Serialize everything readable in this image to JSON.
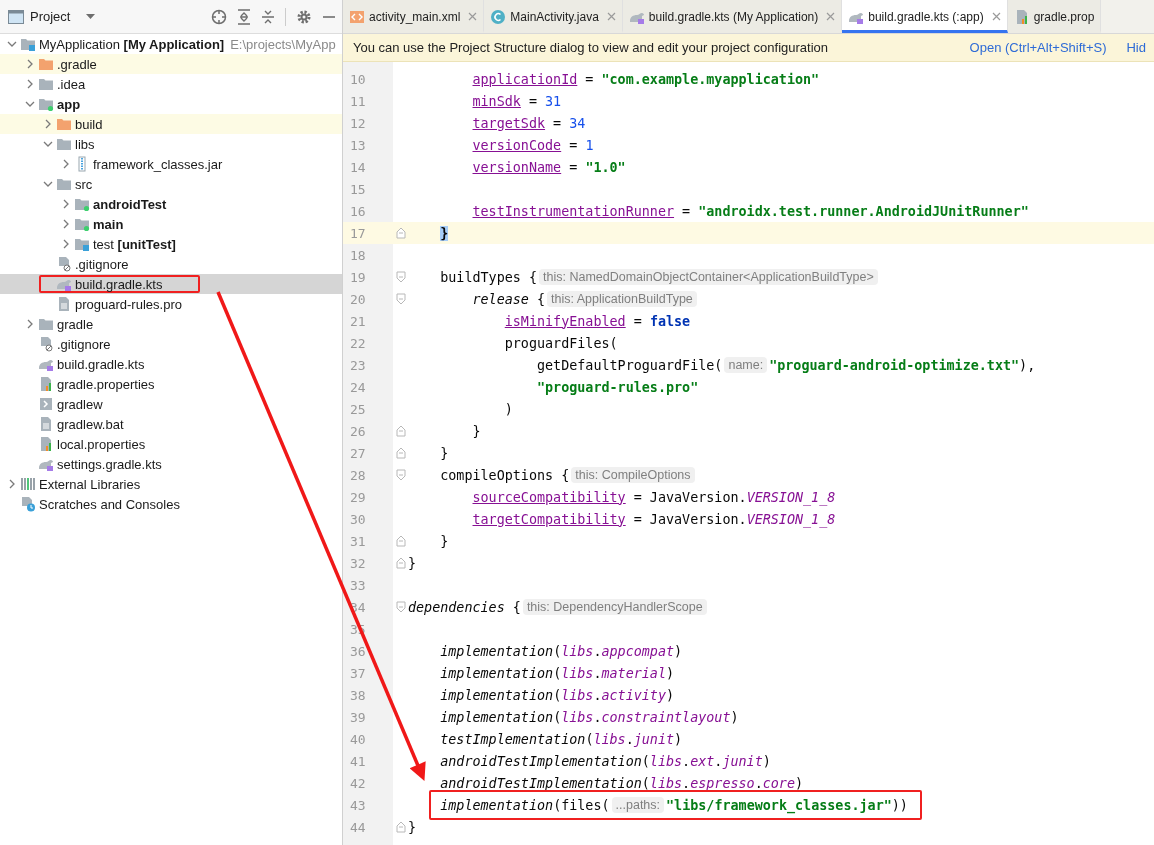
{
  "project_panel": {
    "title": "Project",
    "tree": [
      {
        "label": "MyApplication **[My Application]**",
        "path": "E:\\projects\\MyApp",
        "kind": "project",
        "expanded": true,
        "bold": false,
        "selected": false,
        "excluded": false,
        "highlighted": false,
        "children": [
          {
            "label": ".gradle",
            "kind": "folder-excluded",
            "expanded": false,
            "bold": false,
            "selected": false,
            "excluded": true,
            "highlighted": false
          },
          {
            "label": ".idea",
            "kind": "folder",
            "expanded": false,
            "bold": false,
            "selected": false,
            "excluded": false,
            "highlighted": false
          },
          {
            "label": "app",
            "kind": "module",
            "expanded": true,
            "bold": true,
            "selected": false,
            "excluded": false,
            "highlighted": false,
            "children": [
              {
                "label": "build",
                "kind": "folder-excluded",
                "expanded": false,
                "bold": false,
                "selected": false,
                "excluded": true,
                "highlighted": false
              },
              {
                "label": "libs",
                "kind": "folder",
                "expanded": true,
                "bold": false,
                "selected": false,
                "excluded": false,
                "highlighted": false,
                "children": [
                  {
                    "label": "framework_classes.jar",
                    "kind": "jar",
                    "expanded": false,
                    "bold": false,
                    "selected": false,
                    "excluded": false,
                    "highlighted": false
                  }
                ]
              },
              {
                "label": "src",
                "kind": "folder",
                "expanded": true,
                "bold": false,
                "selected": false,
                "excluded": false,
                "highlighted": false,
                "children": [
                  {
                    "label": "androidTest",
                    "kind": "module",
                    "expanded": false,
                    "bold": true,
                    "selected": false,
                    "excluded": false,
                    "highlighted": false
                  },
                  {
                    "label": "main",
                    "kind": "module",
                    "expanded": false,
                    "bold": true,
                    "selected": false,
                    "excluded": false,
                    "highlighted": false
                  },
                  {
                    "label": "test **[unitTest]**",
                    "kind": "project",
                    "expanded": false,
                    "bold": false,
                    "selected": false,
                    "excluded": false,
                    "highlighted": false
                  }
                ]
              },
              {
                "label": ".gitignore",
                "kind": "ignore",
                "bold": false,
                "selected": false,
                "excluded": false,
                "highlighted": false
              },
              {
                "label": "build.gradle.kts",
                "kind": "gradle",
                "bold": false,
                "selected": true,
                "excluded": false,
                "highlighted": true
              },
              {
                "label": "proguard-rules.pro",
                "kind": "text",
                "bold": false,
                "selected": false,
                "excluded": false,
                "highlighted": false
              }
            ]
          },
          {
            "label": "gradle",
            "kind": "folder",
            "expanded": false,
            "bold": false,
            "selected": false,
            "excluded": false,
            "highlighted": false
          },
          {
            "label": ".gitignore",
            "kind": "ignore",
            "bold": false,
            "selected": false,
            "excluded": false,
            "highlighted": false
          },
          {
            "label": "build.gradle.kts",
            "kind": "gradle",
            "bold": false,
            "selected": false,
            "excluded": false,
            "highlighted": false
          },
          {
            "label": "gradle.properties",
            "kind": "properties",
            "bold": false,
            "selected": false,
            "excluded": false,
            "highlighted": false
          },
          {
            "label": "gradlew",
            "kind": "script",
            "bold": false,
            "selected": false,
            "excluded": false,
            "highlighted": false
          },
          {
            "label": "gradlew.bat",
            "kind": "text",
            "bold": false,
            "selected": false,
            "excluded": false,
            "highlighted": false
          },
          {
            "label": "local.properties",
            "kind": "properties",
            "bold": false,
            "selected": false,
            "excluded": false,
            "highlighted": false
          },
          {
            "label": "settings.gradle.kts",
            "kind": "gradle",
            "bold": false,
            "selected": false,
            "excluded": false,
            "highlighted": false
          }
        ]
      },
      {
        "label": "External Libraries",
        "kind": "libraries",
        "expanded": false,
        "bold": false,
        "selected": false,
        "excluded": false,
        "highlighted": false
      },
      {
        "label": "Scratches and Consoles",
        "kind": "scratches",
        "bold": false,
        "selected": false,
        "excluded": false,
        "highlighted": false
      }
    ]
  },
  "editor_tabs": [
    {
      "label": "activity_main.xml",
      "kind": "xml",
      "selected": false
    },
    {
      "label": "MainActivity.java",
      "kind": "class",
      "selected": false
    },
    {
      "label": "build.gradle.kts (My Application)",
      "kind": "gradle",
      "selected": false
    },
    {
      "label": "build.gradle.kts (:app)",
      "kind": "gradle",
      "selected": true
    },
    {
      "label": "gradle.prop",
      "kind": "properties",
      "selected": false
    }
  ],
  "banner": {
    "message": "You can use the Project Structure dialog to view and edit your project configuration",
    "action": "Open (Ctrl+Alt+Shift+S)",
    "dismiss": "Hid"
  },
  "code_lines": [
    {
      "number": "10",
      "current": false,
      "tokens": [
        {
          "text": "        applicationId",
          "kind": "prop"
        },
        {
          "text": " = ",
          "kind": "plain"
        },
        {
          "text": "\"com.example.myapplication\"",
          "kind": "string"
        }
      ]
    },
    {
      "number": "11",
      "current": false,
      "tokens": [
        {
          "text": "        minSdk",
          "kind": "prop"
        },
        {
          "text": " = ",
          "kind": "plain"
        },
        {
          "text": "31",
          "kind": "number"
        }
      ]
    },
    {
      "number": "12",
      "current": false,
      "tokens": [
        {
          "text": "        targetSdk",
          "kind": "prop"
        },
        {
          "text": " = ",
          "kind": "plain"
        },
        {
          "text": "34",
          "kind": "number"
        }
      ]
    },
    {
      "number": "13",
      "current": false,
      "tokens": [
        {
          "text": "        versionCode",
          "kind": "prop"
        },
        {
          "text": " = ",
          "kind": "plain"
        },
        {
          "text": "1",
          "kind": "number"
        }
      ]
    },
    {
      "number": "14",
      "current": false,
      "tokens": [
        {
          "text": "        versionName",
          "kind": "prop"
        },
        {
          "text": " = ",
          "kind": "plain"
        },
        {
          "text": "\"1.0\"",
          "kind": "string"
        }
      ]
    },
    {
      "number": "15",
      "current": false
    },
    {
      "number": "16",
      "current": false,
      "tokens": [
        {
          "text": "        testInstrumentationRunner",
          "kind": "prop"
        },
        {
          "text": " = ",
          "kind": "plain"
        },
        {
          "text": "\"androidx.test.runner.AndroidJUnitRunner\"",
          "kind": "string"
        }
      ]
    },
    {
      "number": "17",
      "current": true,
      "fold_marker": {
        "kind": "end"
      },
      "tokens": [
        {
          "text": "    }",
          "kind": "brace-match"
        }
      ]
    },
    {
      "number": "18",
      "current": false
    },
    {
      "number": "19",
      "current": false,
      "fold_marker": {
        "kind": "start"
      },
      "tokens": [
        {
          "text": "    buildTypes {",
          "kind": "plain"
        },
        {
          "text": "this: NamedDomainObjectContainer<ApplicationBuildType>",
          "kind": "hint"
        }
      ]
    },
    {
      "number": "20",
      "current": false,
      "fold_marker": {
        "kind": "start"
      },
      "tokens": [
        {
          "text": "        release",
          "kind": "italic"
        },
        {
          "text": " {",
          "kind": "plain"
        },
        {
          "text": "this: ApplicationBuildType",
          "kind": "hint"
        }
      ]
    },
    {
      "number": "21",
      "current": false,
      "tokens": [
        {
          "text": "            isMinifyEnabled",
          "kind": "prop"
        },
        {
          "text": " = ",
          "kind": "plain"
        },
        {
          "text": "false",
          "kind": "keyword"
        }
      ]
    },
    {
      "number": "22",
      "current": false,
      "tokens": [
        {
          "text": "            proguardFiles(",
          "kind": "plain"
        }
      ]
    },
    {
      "number": "23",
      "current": false,
      "tokens": [
        {
          "text": "                getDefaultProguardFile(",
          "kind": "plain"
        },
        {
          "text": "name:",
          "kind": "hint"
        },
        {
          "text": "\"proguard-android-optimize.txt\"",
          "kind": "string"
        },
        {
          "text": "),",
          "kind": "plain"
        }
      ]
    },
    {
      "number": "24",
      "current": false,
      "tokens": [
        {
          "text": "                \"proguard-rules.pro\"",
          "kind": "string"
        }
      ]
    },
    {
      "number": "25",
      "current": false,
      "tokens": [
        {
          "text": "            )",
          "kind": "plain"
        }
      ]
    },
    {
      "number": "26",
      "current": false,
      "fold_marker": {
        "kind": "end"
      },
      "tokens": [
        {
          "text": "        }",
          "kind": "plain"
        }
      ]
    },
    {
      "number": "27",
      "current": false,
      "fold_marker": {
        "kind": "end"
      },
      "tokens": [
        {
          "text": "    }",
          "kind": "plain"
        }
      ]
    },
    {
      "number": "28",
      "current": false,
      "fold_marker": {
        "kind": "start"
      },
      "tokens": [
        {
          "text": "    compileOptions {",
          "kind": "plain"
        },
        {
          "text": "this: CompileOptions",
          "kind": "hint"
        }
      ]
    },
    {
      "number": "29",
      "current": false,
      "tokens": [
        {
          "text": "        sourceCompatibility",
          "kind": "prop"
        },
        {
          "text": " = JavaVersion.",
          "kind": "plain"
        },
        {
          "text": "VERSION_1_8",
          "kind": "member"
        }
      ]
    },
    {
      "number": "30",
      "current": false,
      "tokens": [
        {
          "text": "        targetCompatibility",
          "kind": "prop"
        },
        {
          "text": " = JavaVersion.",
          "kind": "plain"
        },
        {
          "text": "VERSION_1_8",
          "kind": "member"
        }
      ]
    },
    {
      "number": "31",
      "current": false,
      "fold_marker": {
        "kind": "end"
      },
      "tokens": [
        {
          "text": "    }",
          "kind": "plain"
        }
      ]
    },
    {
      "number": "32",
      "current": false,
      "fold_marker": {
        "kind": "end"
      },
      "tokens": [
        {
          "text": "}",
          "kind": "plain"
        }
      ]
    },
    {
      "number": "33",
      "current": false
    },
    {
      "number": "34",
      "current": false,
      "fold_marker": {
        "kind": "start"
      },
      "tokens": [
        {
          "text": "dependencies",
          "kind": "italic"
        },
        {
          "text": " {",
          "kind": "plain"
        },
        {
          "text": "this: DependencyHandlerScope",
          "kind": "hint"
        }
      ]
    },
    {
      "number": "35",
      "current": false
    },
    {
      "number": "36",
      "current": false,
      "tokens": [
        {
          "text": "    implementation",
          "kind": "italic"
        },
        {
          "text": "(",
          "kind": "plain"
        },
        {
          "text": "libs",
          "kind": "member"
        },
        {
          "text": ".",
          "kind": "plain"
        },
        {
          "text": "appcompat",
          "kind": "member"
        },
        {
          "text": ")",
          "kind": "plain"
        }
      ]
    },
    {
      "number": "37",
      "current": false,
      "tokens": [
        {
          "text": "    implementation",
          "kind": "italic"
        },
        {
          "text": "(",
          "kind": "plain"
        },
        {
          "text": "libs",
          "kind": "member"
        },
        {
          "text": ".",
          "kind": "plain"
        },
        {
          "text": "material",
          "kind": "member"
        },
        {
          "text": ")",
          "kind": "plain"
        }
      ]
    },
    {
      "number": "38",
      "current": false,
      "tokens": [
        {
          "text": "    implementation",
          "kind": "italic"
        },
        {
          "text": "(",
          "kind": "plain"
        },
        {
          "text": "libs",
          "kind": "member"
        },
        {
          "text": ".",
          "kind": "plain"
        },
        {
          "text": "activity",
          "kind": "member"
        },
        {
          "text": ")",
          "kind": "plain"
        }
      ]
    },
    {
      "number": "39",
      "current": false,
      "tokens": [
        {
          "text": "    implementation",
          "kind": "italic"
        },
        {
          "text": "(",
          "kind": "plain"
        },
        {
          "text": "libs",
          "kind": "member"
        },
        {
          "text": ".",
          "kind": "plain"
        },
        {
          "text": "constraintlayout",
          "kind": "member"
        },
        {
          "text": ")",
          "kind": "plain"
        }
      ]
    },
    {
      "number": "40",
      "current": false,
      "tokens": [
        {
          "text": "    testImplementation",
          "kind": "italic"
        },
        {
          "text": "(",
          "kind": "plain"
        },
        {
          "text": "libs",
          "kind": "member"
        },
        {
          "text": ".",
          "kind": "plain"
        },
        {
          "text": "junit",
          "kind": "member"
        },
        {
          "text": ")",
          "kind": "plain"
        }
      ]
    },
    {
      "number": "41",
      "current": false,
      "tokens": [
        {
          "text": "    androidTestImplementation",
          "kind": "italic"
        },
        {
          "text": "(",
          "kind": "plain"
        },
        {
          "text": "libs",
          "kind": "member"
        },
        {
          "text": ".",
          "kind": "plain"
        },
        {
          "text": "ext",
          "kind": "member"
        },
        {
          "text": ".",
          "kind": "plain"
        },
        {
          "text": "junit",
          "kind": "member"
        },
        {
          "text": ")",
          "kind": "plain"
        }
      ]
    },
    {
      "number": "42",
      "current": false,
      "tokens": [
        {
          "text": "    androidTestImplementation",
          "kind": "italic"
        },
        {
          "text": "(",
          "kind": "plain"
        },
        {
          "text": "libs",
          "kind": "member"
        },
        {
          "text": ".",
          "kind": "plain"
        },
        {
          "text": "espresso",
          "kind": "member"
        },
        {
          "text": ".",
          "kind": "plain"
        },
        {
          "text": "core",
          "kind": "member"
        },
        {
          "text": ")",
          "kind": "plain"
        }
      ]
    },
    {
      "number": "43",
      "current": false,
      "highlighted": true,
      "tokens": [
        {
          "text": "    implementation",
          "kind": "italic"
        },
        {
          "text": "(files(",
          "kind": "plain"
        },
        {
          "text": "...paths:",
          "kind": "hint"
        },
        {
          "text": "\"libs/framework_classes.jar\"",
          "kind": "string"
        },
        {
          "text": "))",
          "kind": "plain"
        }
      ]
    },
    {
      "number": "44",
      "current": false,
      "fold_marker": {
        "kind": "end"
      },
      "tokens": [
        {
          "text": "}",
          "kind": "plain"
        }
      ]
    }
  ]
}
